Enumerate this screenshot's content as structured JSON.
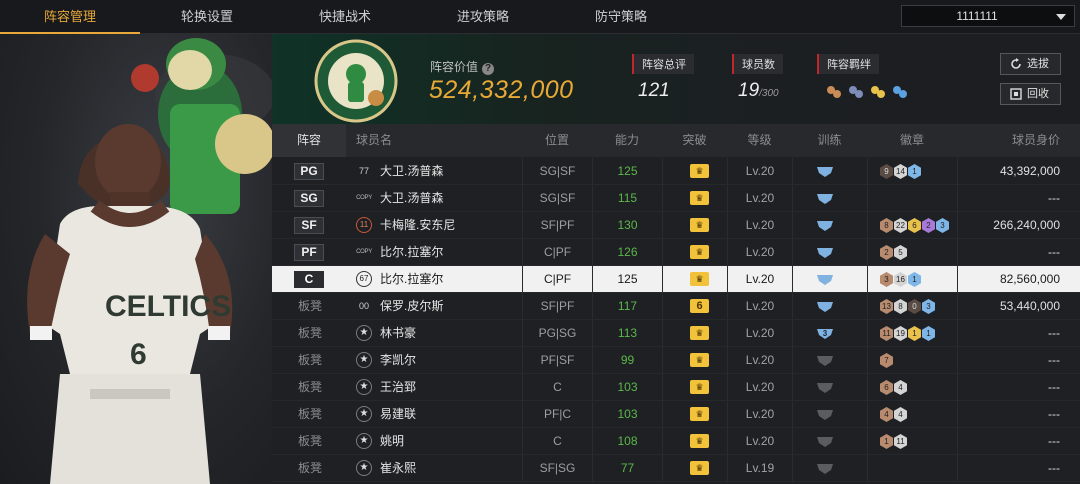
{
  "nav": {
    "tabs": [
      "阵容管理",
      "轮换设置",
      "快捷战术",
      "进攻策略",
      "防守策略"
    ],
    "active_index": 0,
    "team_select": "1111111"
  },
  "header": {
    "value_label": "阵容价值",
    "value": "524,332,000",
    "stats": [
      {
        "label": "阵容总评",
        "value": "121",
        "sub": ""
      },
      {
        "label": "球员数",
        "value": "19",
        "sub": "/300"
      },
      {
        "label": "阵容羁绊",
        "value": "",
        "sub": ""
      }
    ],
    "btn_select": "选拔",
    "btn_recycle": "回收"
  },
  "table": {
    "headers": [
      "阵容",
      "球员名",
      "位置",
      "能力",
      "突破",
      "等级",
      "训练",
      "徽章",
      "球员身价"
    ],
    "rows": [
      {
        "slot": "PG",
        "jersey": "77",
        "jersey_type": "num",
        "name": "大卫.汤普森",
        "pos": "SG|SF",
        "ability": "125",
        "breakthrough": "",
        "level": "Lv.20",
        "training": "",
        "badges": [
          [
            "dark",
            "9"
          ],
          [
            "silver",
            "14"
          ],
          [
            "blue",
            "1"
          ]
        ],
        "value": "43,392,000",
        "selected": false
      },
      {
        "slot": "SG",
        "jersey": "COPY",
        "jersey_type": "copy",
        "name": "大卫.汤普森",
        "pos": "SG|SF",
        "ability": "115",
        "breakthrough": "",
        "level": "Lv.20",
        "training": "",
        "badges": [],
        "value": "---",
        "selected": false
      },
      {
        "slot": "SF",
        "jersey": "11",
        "jersey_type": "red",
        "name": "卡梅隆.安东尼",
        "pos": "SF|PF",
        "ability": "130",
        "breakthrough": "",
        "level": "Lv.20",
        "training": "",
        "badges": [
          [
            "bronze",
            "8"
          ],
          [
            "silver",
            "22"
          ],
          [
            "gold",
            "6"
          ],
          [
            "purple",
            "2"
          ],
          [
            "blue",
            "3"
          ]
        ],
        "value": "266,240,000",
        "selected": false
      },
      {
        "slot": "PF",
        "jersey": "COPY",
        "jersey_type": "copy",
        "name": "比尔.拉塞尔",
        "pos": "C|PF",
        "ability": "126",
        "breakthrough": "",
        "level": "Lv.20",
        "training": "",
        "badges": [
          [
            "bronze",
            "2"
          ],
          [
            "silver",
            "5"
          ]
        ],
        "value": "---",
        "selected": false
      },
      {
        "slot": "C",
        "jersey": "67",
        "jersey_type": "hex",
        "name": "比尔.拉塞尔",
        "pos": "C|PF",
        "ability": "125",
        "breakthrough": "",
        "level": "Lv.20",
        "training": "",
        "badges": [
          [
            "bronze",
            "3"
          ],
          [
            "silver",
            "16"
          ],
          [
            "blue",
            "1"
          ]
        ],
        "value": "82,560,000",
        "selected": true
      },
      {
        "slot": "板凳",
        "jersey": "00",
        "jersey_type": "num",
        "name": "保罗.皮尔斯",
        "pos": "SF|PF",
        "ability": "117",
        "breakthrough": "6",
        "level": "Lv.20",
        "training": "",
        "badges": [
          [
            "bronze",
            "13"
          ],
          [
            "silver",
            "8"
          ],
          [
            "dark",
            "0"
          ],
          [
            "blue",
            "3"
          ]
        ],
        "value": "53,440,000",
        "selected": false
      },
      {
        "slot": "板凳",
        "jersey": "★",
        "jersey_type": "star",
        "name": "林书豪",
        "pos": "PG|SG",
        "ability": "113",
        "breakthrough": "",
        "level": "Lv.20",
        "training": "3",
        "badges": [
          [
            "bronze",
            "11"
          ],
          [
            "silver",
            "19"
          ],
          [
            "gold",
            "1"
          ],
          [
            "blue",
            "1"
          ]
        ],
        "value": "---",
        "selected": false
      },
      {
        "slot": "板凳",
        "jersey": "★",
        "jersey_type": "star",
        "name": "李凯尔",
        "pos": "PF|SF",
        "ability": "99",
        "breakthrough": "",
        "level": "Lv.20",
        "training": "",
        "badges": [
          [
            "bronze",
            "7"
          ]
        ],
        "value": "---",
        "selected": false
      },
      {
        "slot": "板凳",
        "jersey": "★",
        "jersey_type": "star",
        "name": "王治郅",
        "pos": "C",
        "ability": "103",
        "breakthrough": "",
        "level": "Lv.20",
        "training": "",
        "badges": [
          [
            "bronze",
            "6"
          ],
          [
            "silver",
            "4"
          ]
        ],
        "value": "---",
        "selected": false
      },
      {
        "slot": "板凳",
        "jersey": "★",
        "jersey_type": "star",
        "name": "易建联",
        "pos": "PF|C",
        "ability": "103",
        "breakthrough": "",
        "level": "Lv.20",
        "training": "",
        "badges": [
          [
            "bronze",
            "4"
          ],
          [
            "silver",
            "4"
          ]
        ],
        "value": "---",
        "selected": false
      },
      {
        "slot": "板凳",
        "jersey": "★",
        "jersey_type": "star",
        "name": "姚明",
        "pos": "C",
        "ability": "108",
        "breakthrough": "",
        "level": "Lv.20",
        "training": "",
        "badges": [
          [
            "bronze",
            "1"
          ],
          [
            "silver",
            "11"
          ]
        ],
        "value": "---",
        "selected": false
      },
      {
        "slot": "板凳",
        "jersey": "★",
        "jersey_type": "star",
        "name": "崔永熙",
        "pos": "SF|SG",
        "ability": "77",
        "breakthrough": "",
        "level": "Lv.19",
        "training": "",
        "badges": [],
        "value": "---",
        "selected": false
      }
    ]
  }
}
